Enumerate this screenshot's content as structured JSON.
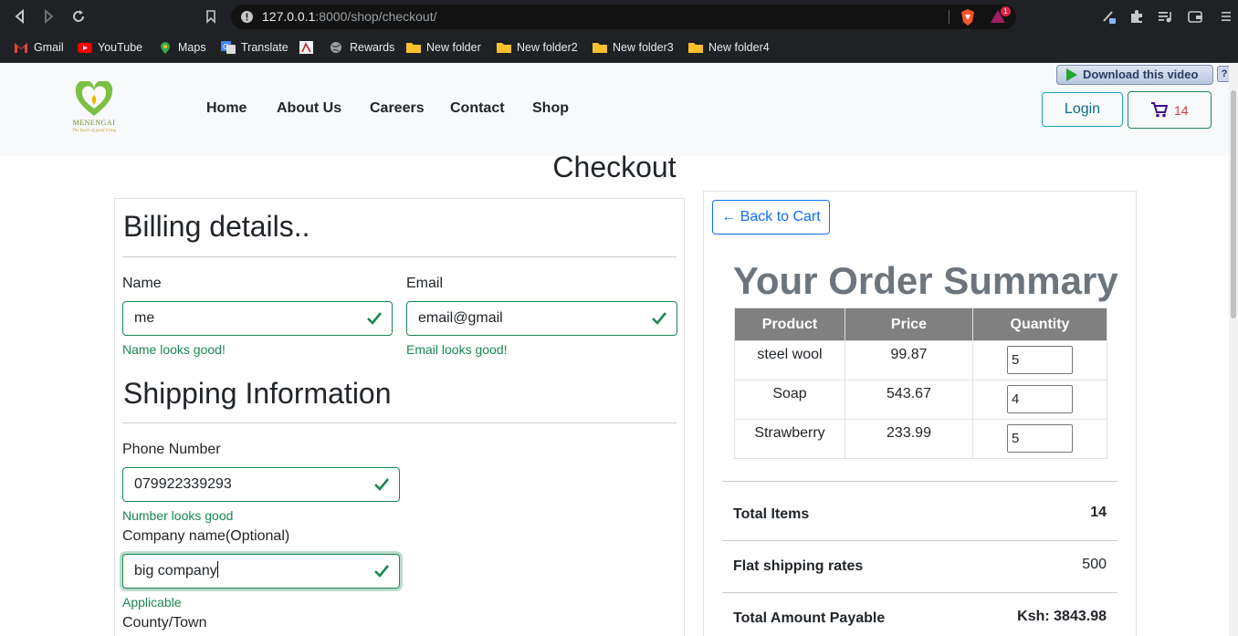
{
  "browser": {
    "url_host": "127.0.0.1",
    "url_path": ":8000/shop/checkout/",
    "brave_badge": "1",
    "bookmarks": [
      "Gmail",
      "YouTube",
      "Maps",
      "Translate",
      "Rewards",
      "New folder",
      "New folder2",
      "New folder3",
      "New folder4"
    ]
  },
  "extension": {
    "download_label": "Download this video",
    "help_label": "?"
  },
  "header": {
    "logo_name": "MENENGAI",
    "logo_tagline": "The heart of good living",
    "nav": [
      "Home",
      "About Us",
      "Careers",
      "Contact",
      "Shop"
    ],
    "login_label": "Login",
    "cart_count": "14"
  },
  "page": {
    "title": "Checkout"
  },
  "billing": {
    "heading": "Billing details..",
    "name_label": "Name",
    "name_value": "me",
    "name_feedback": "Name looks good!",
    "email_label": "Email",
    "email_value": "email@gmail",
    "email_feedback": "Email looks good!"
  },
  "shipping": {
    "heading": "Shipping Information",
    "phone_label": "Phone Number",
    "phone_value": "079922339293",
    "phone_feedback": "Number looks good",
    "company_label": "Company name(Optional)",
    "company_value": "big company",
    "company_feedback": "Applicable",
    "county_label": "County/Town"
  },
  "summary": {
    "back_label": "← Back to Cart",
    "heading": "Your Order Summary",
    "columns": [
      "Product",
      "Price",
      "Quantity"
    ],
    "rows": [
      {
        "product": "steel wool",
        "price": "99.87",
        "qty": "5"
      },
      {
        "product": "Soap",
        "price": "543.67",
        "qty": "4"
      },
      {
        "product": "Strawberry",
        "price": "233.99",
        "qty": "5"
      }
    ],
    "total_items_label": "Total Items",
    "total_items_value": "14",
    "shipping_label": "Flat shipping rates",
    "shipping_value": "500",
    "total_label": "Total Amount Payable",
    "total_value": "Ksh: 3843.98"
  },
  "colors": {
    "success": "#198754",
    "primary": "#0d6efd",
    "table_header": "#808080",
    "cart_count": "#dc3545"
  }
}
